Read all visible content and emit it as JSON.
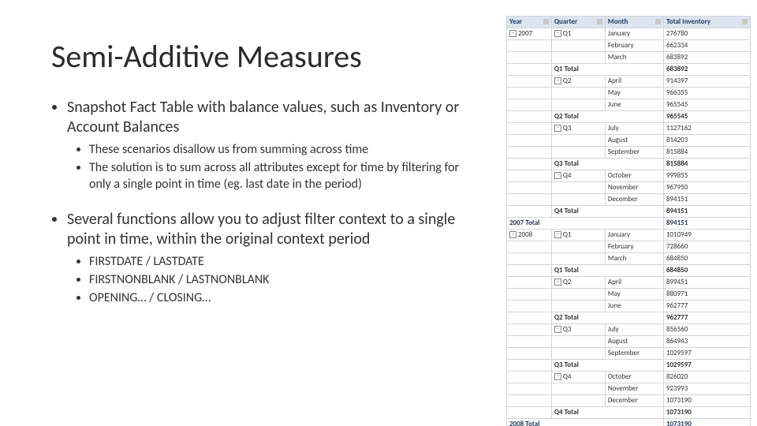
{
  "title": "Semi-Additive Measures",
  "bullets": {
    "b1": "Snapshot Fact Table with balance values, such as Inventory or Account Balances",
    "b1a": "These scenarios disallow us from summing across time",
    "b1b": "The solution is to sum across all attributes except for time by filtering for only a single point in time (eg. last date in the period)",
    "b2": "Several functions allow you to adjust filter context to a single point in time, within the original context period",
    "b2a": "FIRSTDATE / LASTDATE",
    "b2b": "FIRSTNONBLANK / LASTNONBLANK",
    "b2c": "OPENING… / CLOSING…"
  },
  "pivot": {
    "headers": {
      "h1": "Year",
      "h2": "Quarter",
      "h3": "Month",
      "h4": "Total Inventory"
    },
    "rows": [
      {
        "year": "2007",
        "q": "Q1",
        "month": "January",
        "val": "276780",
        "first": true
      },
      {
        "year": "",
        "q": "",
        "month": "February",
        "val": "662334"
      },
      {
        "year": "",
        "q": "",
        "month": "March",
        "val": "683892"
      },
      {
        "subtotal": "Q1 Total",
        "val": "683892"
      },
      {
        "year": "",
        "q": "Q2",
        "month": "April",
        "val": "914397"
      },
      {
        "year": "",
        "q": "",
        "month": "May",
        "val": "966355"
      },
      {
        "year": "",
        "q": "",
        "month": "June",
        "val": "965545"
      },
      {
        "subtotal": "Q2 Total",
        "val": "965545"
      },
      {
        "year": "",
        "q": "Q3",
        "month": "July",
        "val": "1127162"
      },
      {
        "year": "",
        "q": "",
        "month": "August",
        "val": "814203"
      },
      {
        "year": "",
        "q": "",
        "month": "September",
        "val": "815884"
      },
      {
        "subtotal": "Q3 Total",
        "val": "815884"
      },
      {
        "year": "",
        "q": "Q4",
        "month": "October",
        "val": "999855"
      },
      {
        "year": "",
        "q": "",
        "month": "November",
        "val": "967950"
      },
      {
        "year": "",
        "q": "",
        "month": "December",
        "val": "894151"
      },
      {
        "subtotal": "Q4 Total",
        "val": "894151"
      },
      {
        "yeartotal": "2007 Total",
        "val": "894151"
      },
      {
        "year": "2008",
        "q": "Q1",
        "month": "January",
        "val": "1010949",
        "first": true
      },
      {
        "year": "",
        "q": "",
        "month": "February",
        "val": "728660"
      },
      {
        "year": "",
        "q": "",
        "month": "March",
        "val": "684850"
      },
      {
        "subtotal": "Q1 Total",
        "val": "684850"
      },
      {
        "year": "",
        "q": "Q2",
        "month": "April",
        "val": "899451"
      },
      {
        "year": "",
        "q": "",
        "month": "May",
        "val": "880971"
      },
      {
        "year": "",
        "q": "",
        "month": "June",
        "val": "962777"
      },
      {
        "subtotal": "Q2 Total",
        "val": "962777"
      },
      {
        "year": "",
        "q": "Q3",
        "month": "July",
        "val": "856560"
      },
      {
        "year": "",
        "q": "",
        "month": "August",
        "val": "864943"
      },
      {
        "year": "",
        "q": "",
        "month": "September",
        "val": "1029597"
      },
      {
        "subtotal": "Q3 Total",
        "val": "1029597"
      },
      {
        "year": "",
        "q": "Q4",
        "month": "October",
        "val": "826020"
      },
      {
        "year": "",
        "q": "",
        "month": "November",
        "val": "923993"
      },
      {
        "year": "",
        "q": "",
        "month": "December",
        "val": "1073190"
      },
      {
        "subtotal": "Q4 Total",
        "val": "1073190"
      },
      {
        "yeartotal": "2008 Total",
        "val": "1073190"
      }
    ]
  }
}
